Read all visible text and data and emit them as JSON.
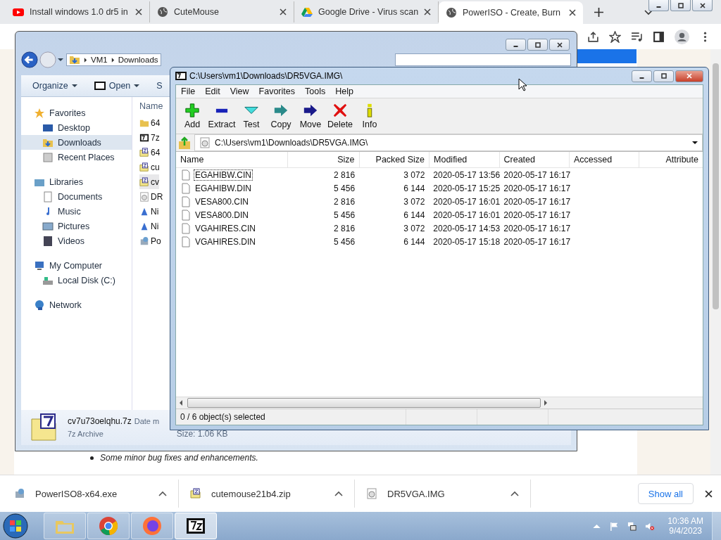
{
  "browser": {
    "tabs": [
      {
        "title": "Install windows 1.0 dr5 in",
        "kind": "video",
        "selected": false
      },
      {
        "title": "CuteMouse",
        "kind": "globe",
        "selected": false
      },
      {
        "title": "Google Drive - Virus scan",
        "kind": "drive",
        "selected": false
      },
      {
        "title": "PowerISO - Create, Burn",
        "kind": "globe",
        "selected": true
      }
    ],
    "page_text": "Some minor bug fixes and enhancements."
  },
  "explorer": {
    "breadcrumb": [
      "VM1",
      "Downloads"
    ],
    "toolbar": [
      "Organize",
      "Open",
      "S"
    ],
    "nav": [
      {
        "label": "Favorites",
        "kind": "star",
        "children": [
          {
            "label": "Desktop",
            "kind": "desktop",
            "selected": false
          },
          {
            "label": "Downloads",
            "kind": "downloads",
            "selected": true
          },
          {
            "label": "Recent Places",
            "kind": "recent",
            "selected": false
          }
        ]
      },
      {
        "label": "Libraries",
        "kind": "library",
        "children": [
          {
            "label": "Documents",
            "kind": "document",
            "selected": false
          },
          {
            "label": "Music",
            "kind": "music",
            "selected": false
          },
          {
            "label": "Pictures",
            "kind": "pictures",
            "selected": false
          },
          {
            "label": "Videos",
            "kind": "videos",
            "selected": false
          }
        ]
      },
      {
        "label": "My Computer",
        "kind": "computer",
        "children": [
          {
            "label": "Local Disk (C:)",
            "kind": "disk",
            "selected": false
          }
        ]
      },
      {
        "label": "Network",
        "kind": "network"
      }
    ],
    "column": "Name",
    "files": [
      {
        "name": "64",
        "kind": "folder",
        "selected": false
      },
      {
        "name": "7z",
        "kind": "sevenzip",
        "selected": false
      },
      {
        "name": "64",
        "kind": "zip",
        "selected": false
      },
      {
        "name": "cu",
        "kind": "zip",
        "selected": false
      },
      {
        "name": "cv",
        "kind": "archive",
        "selected": true
      },
      {
        "name": "DR",
        "kind": "disc",
        "selected": false
      },
      {
        "name": "Ni",
        "kind": "blue",
        "selected": false
      },
      {
        "name": "Ni",
        "kind": "blue",
        "selected": false
      },
      {
        "name": "Po",
        "kind": "installer",
        "selected": false
      }
    ],
    "details": {
      "name": "cv7u73oelqhu.7z",
      "date_label": "Date m",
      "type": "7z Archive",
      "size": "Size: 1.06 KB"
    }
  },
  "sevenzip": {
    "title": "C:\\Users\\vm1\\Downloads\\DR5VGA.IMG\\",
    "menu": [
      "File",
      "Edit",
      "View",
      "Favorites",
      "Tools",
      "Help"
    ],
    "tools": [
      {
        "label": "Add",
        "kind": "add"
      },
      {
        "label": "Extract",
        "kind": "extract"
      },
      {
        "label": "Test",
        "kind": "test"
      },
      {
        "label": "Copy",
        "kind": "copy"
      },
      {
        "label": "Move",
        "kind": "move"
      },
      {
        "label": "Delete",
        "kind": "delete"
      },
      {
        "label": "Info",
        "kind": "info"
      }
    ],
    "path": "C:\\Users\\vm1\\Downloads\\DR5VGA.IMG\\",
    "columns": [
      "Name",
      "Size",
      "Packed Size",
      "Modified",
      "Created",
      "Accessed",
      "Attribute"
    ],
    "rows": [
      {
        "name": "EGAHIBW.CIN",
        "size": "2 816",
        "packed": "3 072",
        "modified": "2020-05-17 13:56",
        "created": "2020-05-17 16:17",
        "focused": true
      },
      {
        "name": "EGAHIBW.DIN",
        "size": "5 456",
        "packed": "6 144",
        "modified": "2020-05-17 15:25",
        "created": "2020-05-17 16:17",
        "focused": false
      },
      {
        "name": "VESA800.CIN",
        "size": "2 816",
        "packed": "3 072",
        "modified": "2020-05-17 16:01",
        "created": "2020-05-17 16:17",
        "focused": false
      },
      {
        "name": "VESA800.DIN",
        "size": "5 456",
        "packed": "6 144",
        "modified": "2020-05-17 16:01",
        "created": "2020-05-17 16:17",
        "focused": false
      },
      {
        "name": "VGAHIRES.CIN",
        "size": "2 816",
        "packed": "3 072",
        "modified": "2020-05-17 14:53",
        "created": "2020-05-17 16:17",
        "focused": false
      },
      {
        "name": "VGAHIRES.DIN",
        "size": "5 456",
        "packed": "6 144",
        "modified": "2020-05-17 15:18",
        "created": "2020-05-17 16:17",
        "focused": false
      }
    ],
    "status": "0 / 6 object(s) selected"
  },
  "downloads": [
    {
      "name": "PowerISO8-x64.exe",
      "kind": "installer"
    },
    {
      "name": "cutemouse21b4.zip",
      "kind": "zip"
    },
    {
      "name": "DR5VGA.IMG",
      "kind": "disc"
    }
  ],
  "show_all": "Show all",
  "taskbar": {
    "apps": [
      {
        "kind": "explorer",
        "selected": false
      },
      {
        "kind": "chrome",
        "selected": false
      },
      {
        "kind": "firefox",
        "selected": false
      },
      {
        "kind": "sevenzip",
        "selected": true
      }
    ],
    "time": "10:36 AM",
    "date": "9/4/2023"
  }
}
